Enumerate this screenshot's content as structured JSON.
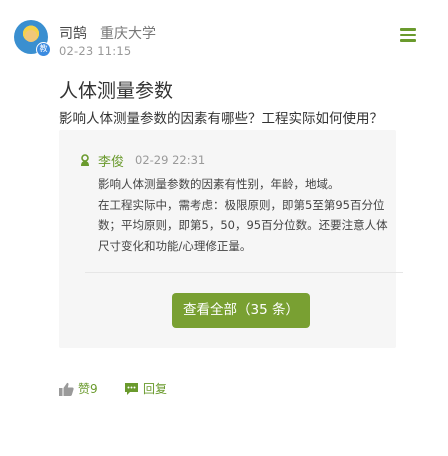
{
  "post": {
    "author": "司鹄",
    "school": "重庆大学",
    "time": "02-23 11:15",
    "badge": "教",
    "title": "人体测量参数",
    "question": "影响人体测量参数的因素有哪些？工程实际如何使用？"
  },
  "answer": {
    "author": "李俊",
    "time": "02-29 22:31",
    "lines": [
      "影响人体测量参数的因素有性别，年龄，地域。",
      "在工程实际中，需考虑：极限原则，即第5至第95百分位",
      "数；平均原则，即第5，50，95百分位数。还要注意人体",
      "尺寸变化和功能/心理修正量。"
    ]
  },
  "view_all_label": "查看全部（35 条）",
  "actions": {
    "like_label": "赞9",
    "reply_label": "回复"
  },
  "colors": {
    "accent": "#79a032",
    "text_green": "#6a9a2d",
    "box_bg": "#f6f6f6"
  },
  "icons": [
    "menu-icon",
    "user-icon",
    "thumbs-up-icon",
    "comment-icon"
  ]
}
